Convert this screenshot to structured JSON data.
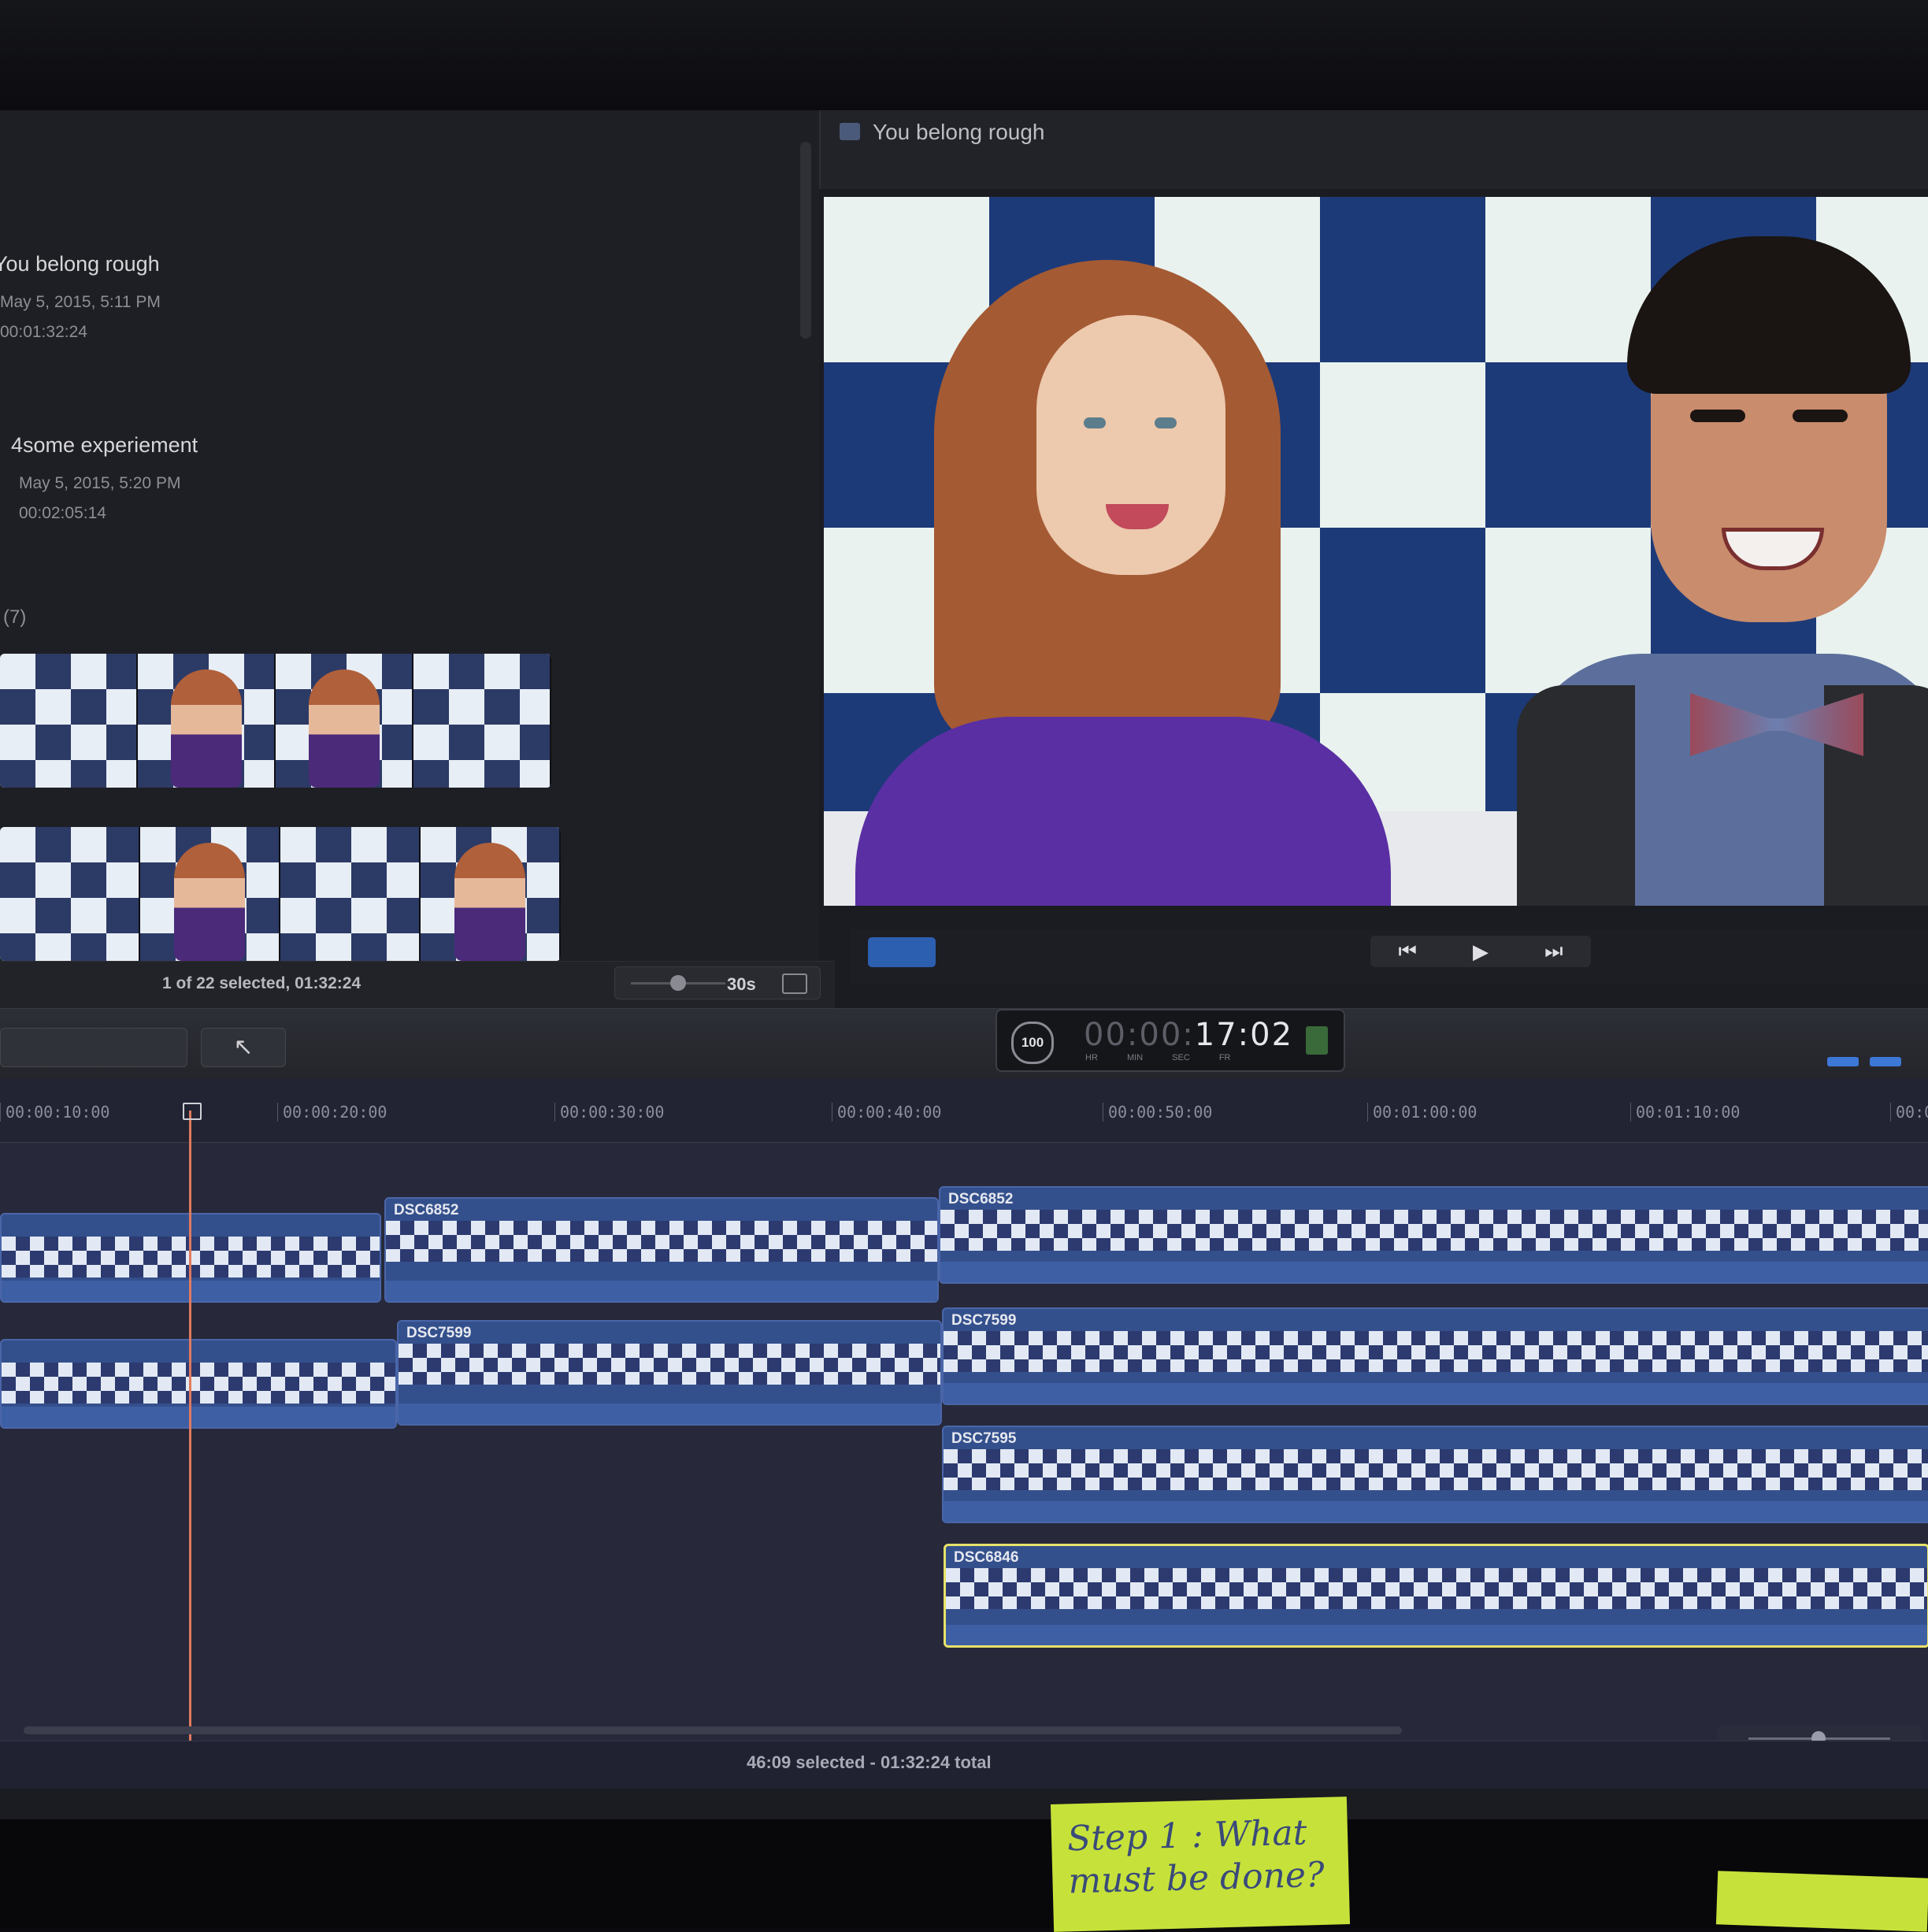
{
  "library": {
    "projects": [
      {
        "title": "You belong rough",
        "date": "May 5, 2015, 5:11 PM",
        "duration": "00:01:32:24"
      },
      {
        "title": "4some experiement",
        "date": "May 5, 2015, 5:20 PM",
        "duration": "00:02:05:14"
      }
    ],
    "event_count": "(7)",
    "status": "1 of 22 selected, 01:32:24",
    "zoom_label": "30s"
  },
  "viewer": {
    "title": "You belong rough",
    "transport": {
      "prev": "⏮",
      "play": "▶",
      "next": "⏭"
    }
  },
  "toolbar": {
    "select_tool": "↖",
    "timecode": {
      "percent": "100",
      "dim": "00:00:",
      "bright": "17:02",
      "units": "HR MIN SEC FR"
    }
  },
  "timeline": {
    "ticks": [
      "00:00:10:00",
      "00:00:20:00",
      "00:00:30:00",
      "00:00:40:00",
      "00:00:50:00",
      "00:01:00:00",
      "00:01:10:00",
      "00:0"
    ],
    "clips": [
      {
        "name": ""
      },
      {
        "name": "DSC6852"
      },
      {
        "name": "DSC6852"
      },
      {
        "name": ""
      },
      {
        "name": "DSC7599"
      },
      {
        "name": "DSC7599"
      },
      {
        "name": "DSC7595"
      },
      {
        "name": "DSC6846"
      }
    ],
    "status": "46:09 selected - 01:32:24 total"
  },
  "desk": {
    "sticky_note": "Step 1 : What must be done?"
  },
  "colors": {
    "accent": "#3d78d6",
    "selection": "#e8e26a",
    "playhead": "#e07a5f",
    "clip": "#34508c"
  }
}
